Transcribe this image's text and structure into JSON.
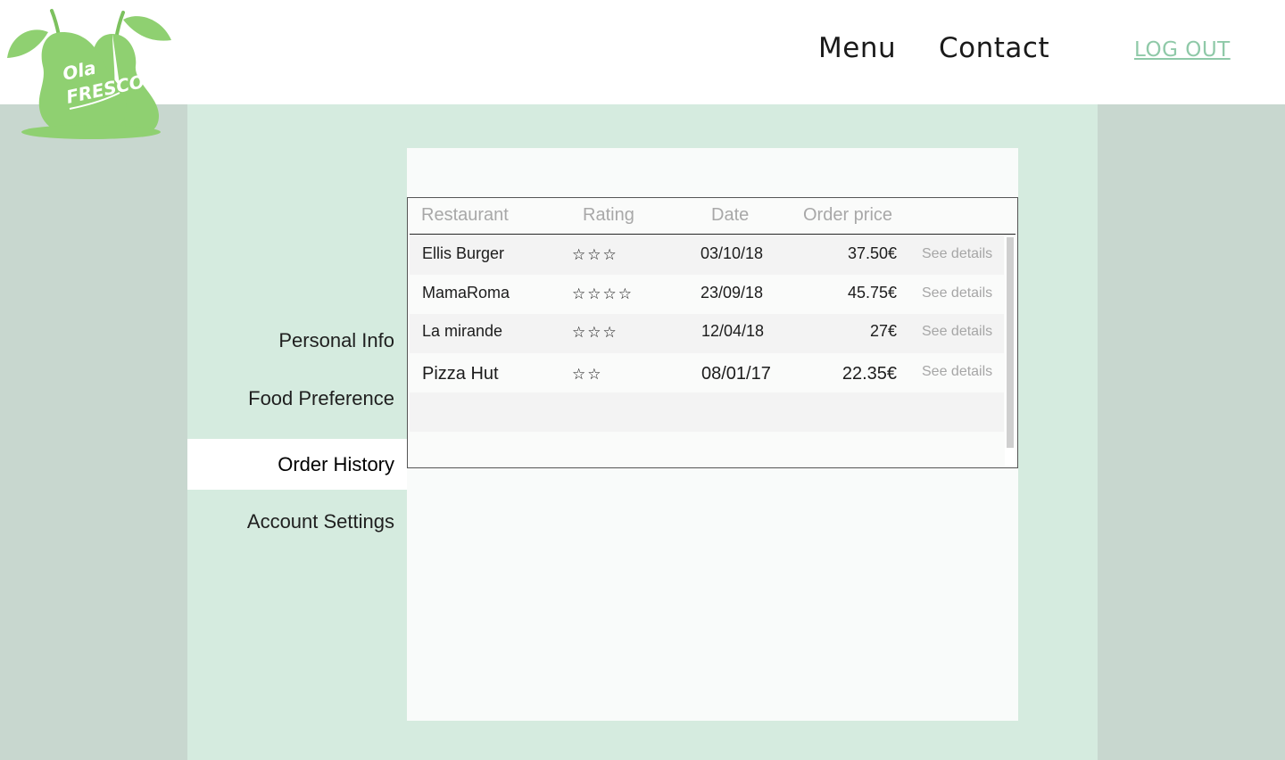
{
  "header": {
    "nav": {
      "menu": "Menu",
      "contact": "Contact"
    },
    "logout": "LOG OUT"
  },
  "logo": {
    "line1": "Ola",
    "line2": "FRESCO",
    "color": "#8fd071"
  },
  "sidebar": {
    "items": [
      {
        "label": "Personal Info",
        "active": false
      },
      {
        "label": "Food Preference",
        "active": false
      },
      {
        "label": "Order History",
        "active": true
      },
      {
        "label": "Account Settings",
        "active": false
      }
    ]
  },
  "orders": {
    "columns": [
      "Restaurant",
      "Rating",
      "Date",
      "Order price"
    ],
    "rows": [
      {
        "restaurant": "Ellis Burger",
        "rating": 3,
        "stars": "☆☆☆",
        "date": "03/10/18",
        "price": "37.50€",
        "action": "See details"
      },
      {
        "restaurant": "MamaRoma",
        "rating": 4,
        "stars": "☆☆☆☆",
        "date": "23/09/18",
        "price": "45.75€",
        "action": "See details"
      },
      {
        "restaurant": "La mirande",
        "rating": 3,
        "stars": "☆☆☆",
        "date": "12/04/18",
        "price": "27€",
        "action": "See details"
      },
      {
        "restaurant": "Pizza Hut",
        "rating": 2,
        "stars": "☆☆",
        "date": "08/01/17",
        "price": "22.35€",
        "action": "See details"
      }
    ]
  },
  "colors": {
    "outer_bg": "#c8d7cf",
    "main_bg": "#d5ebdf",
    "accent": "#8fc9a8"
  }
}
